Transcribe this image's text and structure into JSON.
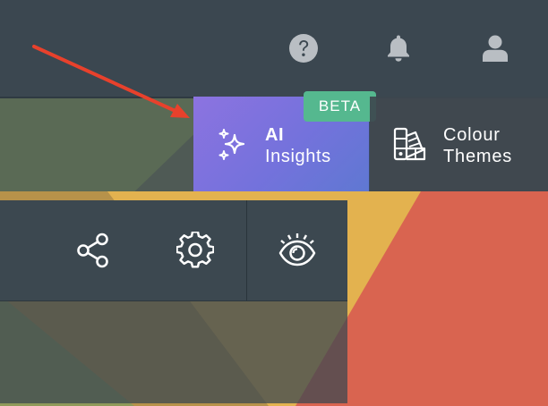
{
  "topbar": {
    "icons": [
      "help-icon",
      "bell-icon",
      "user-icon"
    ]
  },
  "ai_insights": {
    "label_line1": "AI",
    "label_line2": "Insights",
    "badge": "BETA",
    "icon": "sparkles-icon"
  },
  "colour_themes": {
    "label_line1": "Colour",
    "label_line2": "Themes",
    "icon": "palette-swatch-icon"
  },
  "toolbar": {
    "icons": [
      "share-icon",
      "gear-icon",
      "eye-icon"
    ]
  },
  "colors": {
    "topbar": "#3b4750",
    "ai_gradient_start": "#8c73e0",
    "ai_gradient_end": "#5f78d2",
    "beta_badge": "#55b88f",
    "arrow": "#e8412c",
    "icon_gray": "#b9bec3"
  }
}
